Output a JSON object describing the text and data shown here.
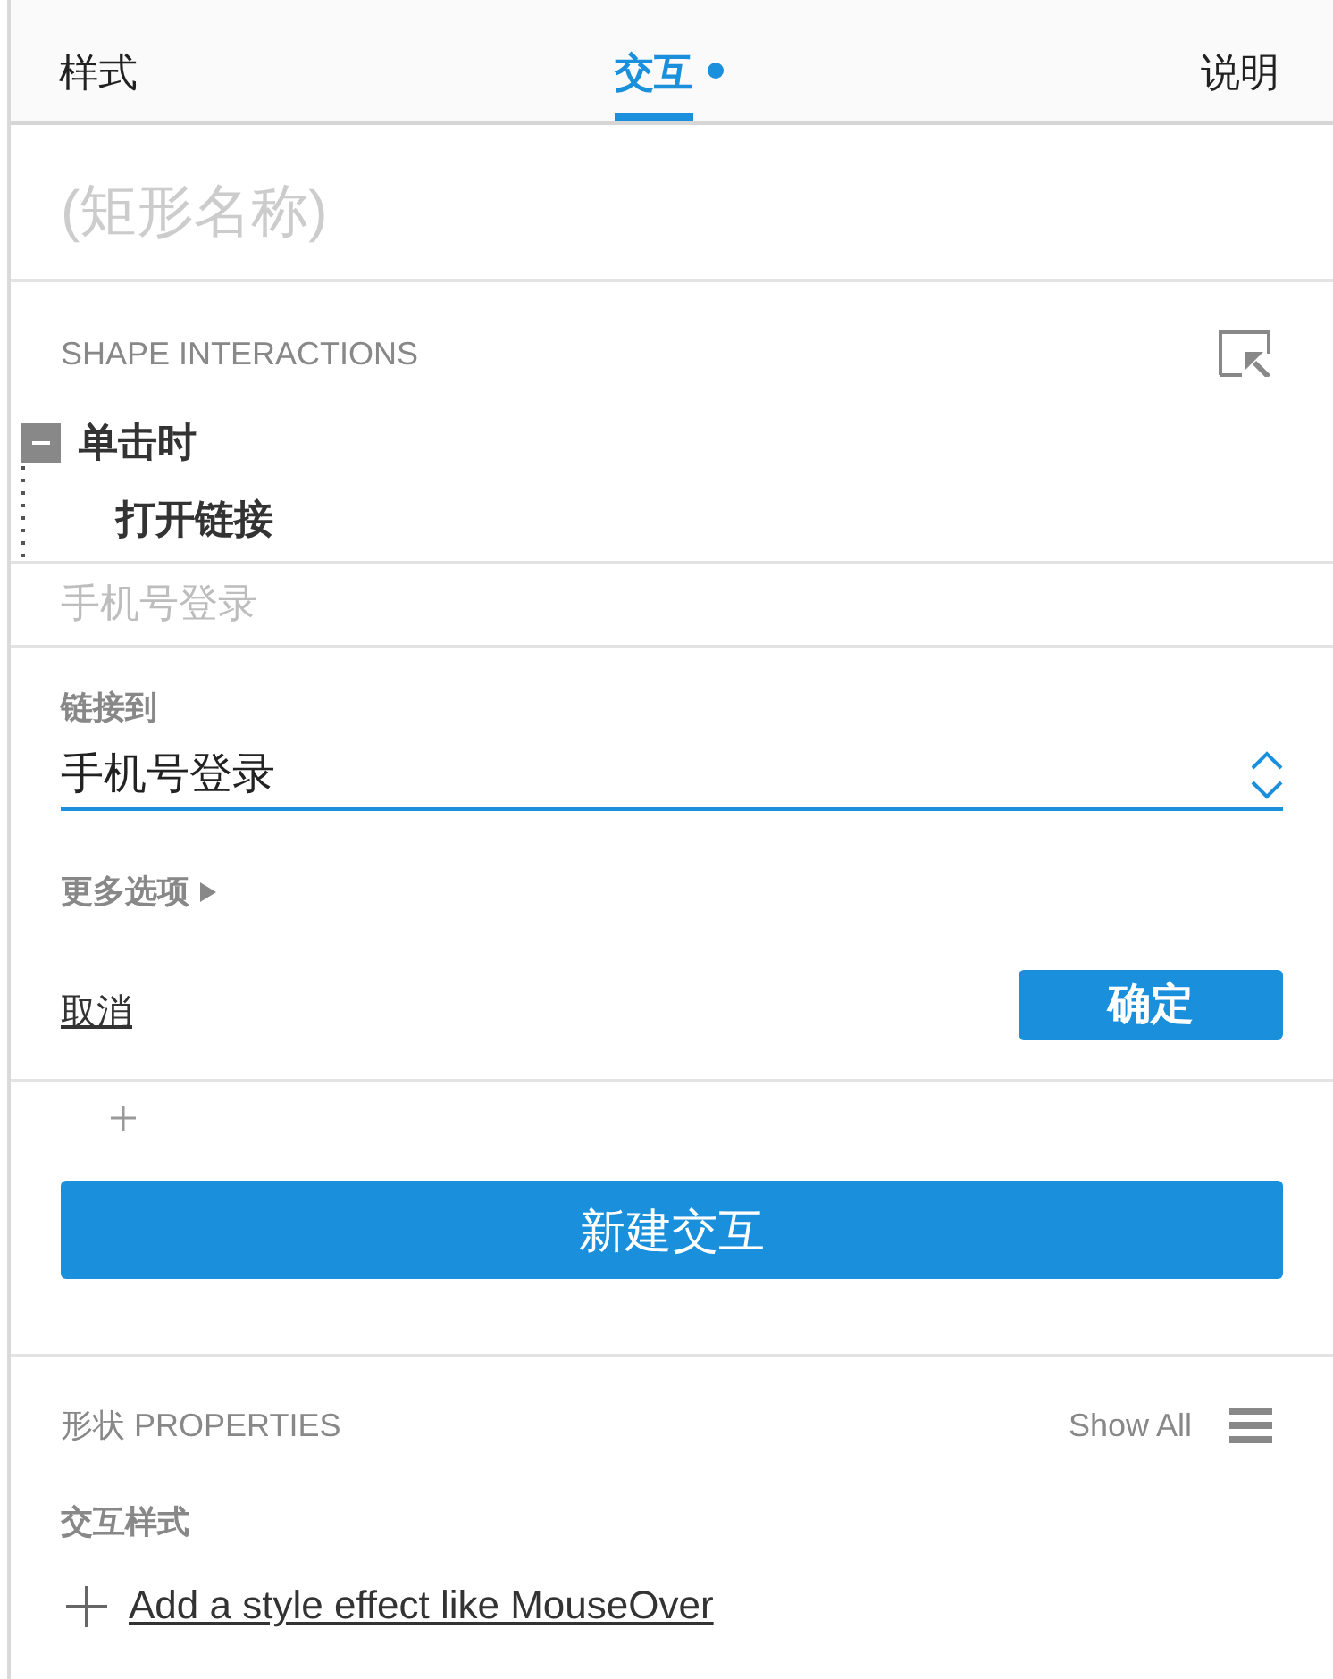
{
  "tabs": [
    {
      "label": "样式",
      "selected": false,
      "modified": false
    },
    {
      "label": "交互",
      "selected": true,
      "modified": true
    },
    {
      "label": "说明",
      "selected": false,
      "modified": false
    }
  ],
  "name_field": {
    "placeholder": "(矩形名称)"
  },
  "interactions": {
    "title": "SHAPE INTERACTIONS",
    "events": [
      {
        "label": "单击时",
        "expanded": true,
        "actions": [
          {
            "label": "打开链接",
            "target": "手机号登录"
          }
        ]
      }
    ]
  },
  "link_editor": {
    "label": "链接到",
    "value": "手机号登录",
    "more_options": "更多选项",
    "cancel": "取消",
    "confirm": "确定"
  },
  "add_interaction": {
    "label": "新建交互"
  },
  "properties": {
    "title": "形状 PROPERTIES",
    "show_all": "Show All",
    "section": "交互样式",
    "add_style_link": "Add a style effect like MouseOver"
  }
}
